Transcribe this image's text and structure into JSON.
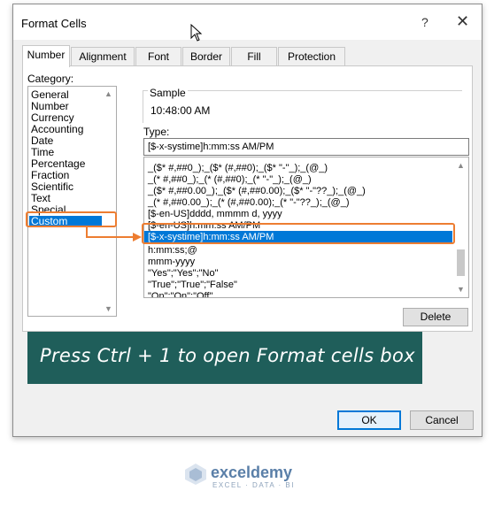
{
  "dialog": {
    "title": "Format Cells",
    "help_glyph": "?",
    "close_glyph": "✕"
  },
  "tabs": [
    {
      "label": "Number",
      "active": true
    },
    {
      "label": "Alignment",
      "active": false
    },
    {
      "label": "Font",
      "active": false
    },
    {
      "label": "Border",
      "active": false
    },
    {
      "label": "Fill",
      "active": false
    },
    {
      "label": "Protection",
      "active": false
    }
  ],
  "category": {
    "label": "Category:",
    "items": [
      "General",
      "Number",
      "Currency",
      "Accounting",
      "Date",
      "Time",
      "Percentage",
      "Fraction",
      "Scientific",
      "Text",
      "Special",
      "Custom"
    ],
    "selected": "Custom"
  },
  "sample": {
    "label": "Sample",
    "value": "10:48:00 AM"
  },
  "type": {
    "label": "Type:",
    "value": "[$-x-systime]h:mm:ss AM/PM",
    "formats": [
      "_($* #,##0_);_($* (#,##0);_($* \"-\"_);_(@_)",
      "_(* #,##0_);_(* (#,##0);_(* \"-\"_);_(@_)",
      "_($* #,##0.00_);_($* (#,##0.00);_($* \"-\"??_);_(@_)",
      "_(* #,##0.00_);_(* (#,##0.00);_(* \"-\"??_);_(@_)",
      "[$-en-US]dddd, mmmm d, yyyy",
      "[$-en-US]h:mm:ss AM/PM",
      "[$-x-systime]h:mm:ss AM/PM",
      "h:mm:ss;@",
      "mmm-yyyy",
      "\"Yes\";\"Yes\";\"No\"",
      "\"True\";\"True\";\"False\"",
      "\"On\";\"On\";\"Off\""
    ],
    "selected_index": 6
  },
  "buttons": {
    "delete": "Delete",
    "ok": "OK",
    "cancel": "Cancel"
  },
  "banner": {
    "text": "Press Ctrl + 1 to open Format cells box",
    "bg_color": "#1f5e5a"
  },
  "accent_color": "#ed7d31",
  "selection_color": "#0078d7",
  "watermark": {
    "name": "exceldemy",
    "tagline": "EXCEL · DATA · BI"
  }
}
